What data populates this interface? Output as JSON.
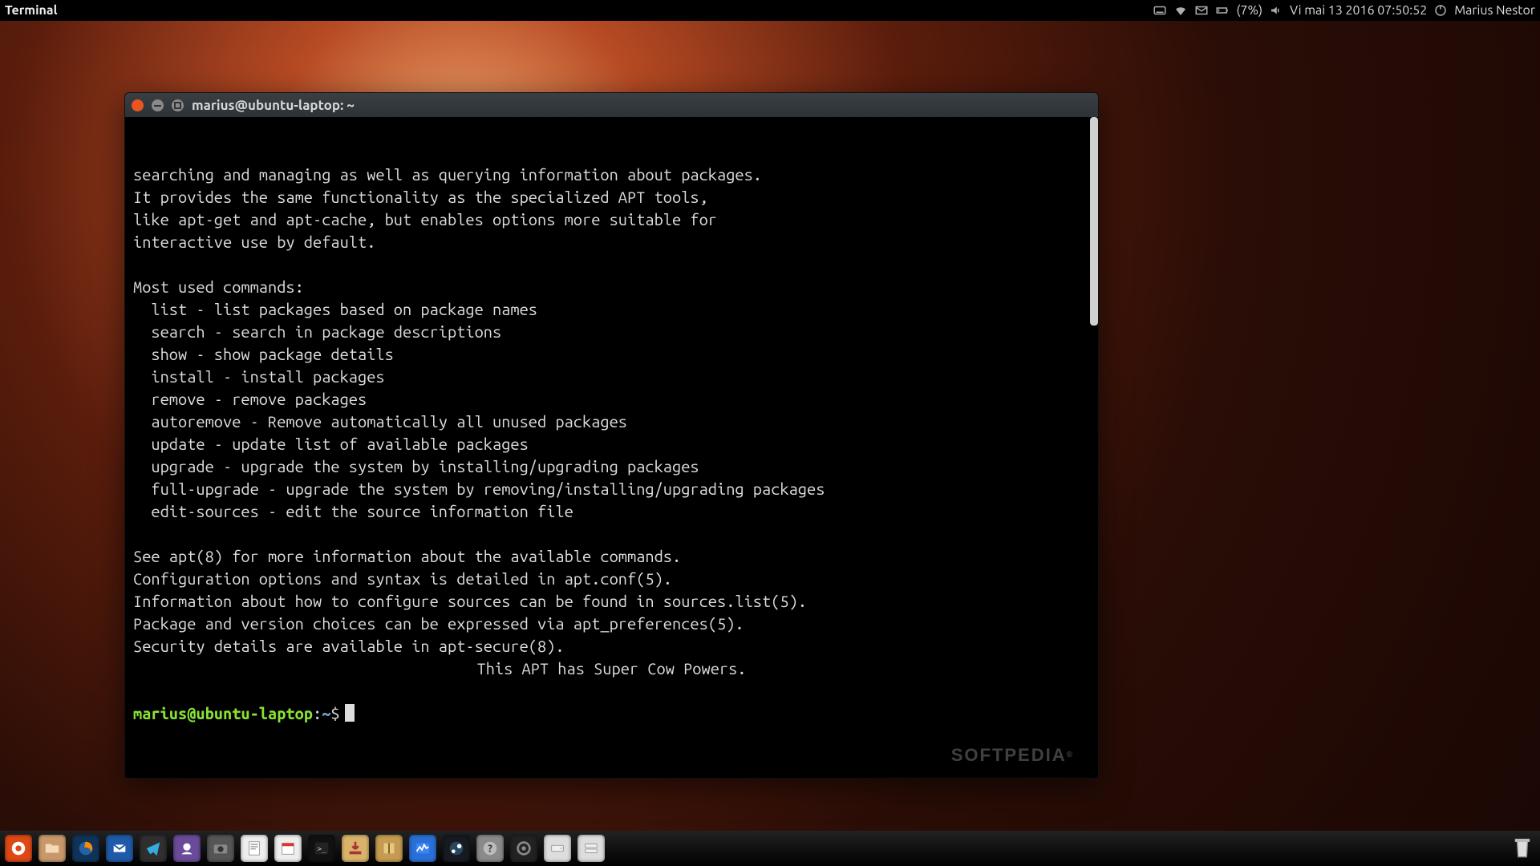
{
  "panel": {
    "app_title": "Terminal",
    "battery_text": "(7%)",
    "clock": "Vi mai 13 2016 07:50:52",
    "username": "Marius Nestor"
  },
  "window": {
    "title": "marius@ubuntu-laptop: ~"
  },
  "terminal": {
    "lines": [
      "searching and managing as well as querying information about packages.",
      "It provides the same functionality as the specialized APT tools,",
      "like apt-get and apt-cache, but enables options more suitable for",
      "interactive use by default.",
      "",
      "Most used commands:",
      "  list - list packages based on package names",
      "  search - search in package descriptions",
      "  show - show package details",
      "  install - install packages",
      "  remove - remove packages",
      "  autoremove - Remove automatically all unused packages",
      "  update - update list of available packages",
      "  upgrade - upgrade the system by installing/upgrading packages",
      "  full-upgrade - upgrade the system by removing/installing/upgrading packages",
      "  edit-sources - edit the source information file",
      "",
      "See apt(8) for more information about the available commands.",
      "Configuration options and syntax is detailed in apt.conf(5).",
      "Information about how to configure sources can be found in sources.list(5).",
      "Package and version choices can be expressed via apt_preferences(5).",
      "Security details are available in apt-secure(8)."
    ],
    "centered_line": "This APT has Super Cow Powers.",
    "prompt_user": "marius@ubuntu-laptop",
    "prompt_sep": ":",
    "prompt_path": "~",
    "prompt_dollar": "$"
  },
  "watermark": "SOFTPEDIA",
  "dock": {
    "items": [
      "show-applications-icon",
      "files-icon",
      "firefox-icon",
      "thunderbird-icon",
      "telegram-icon",
      "pidgin-icon",
      "camera-icon",
      "text-editor-icon",
      "calendar-icon",
      "terminal-icon",
      "software-installer-icon",
      "archive-manager-icon",
      "system-monitor-icon",
      "steam-icon",
      "help-icon",
      "obs-icon",
      "disk1-icon",
      "disk2-icon"
    ]
  }
}
